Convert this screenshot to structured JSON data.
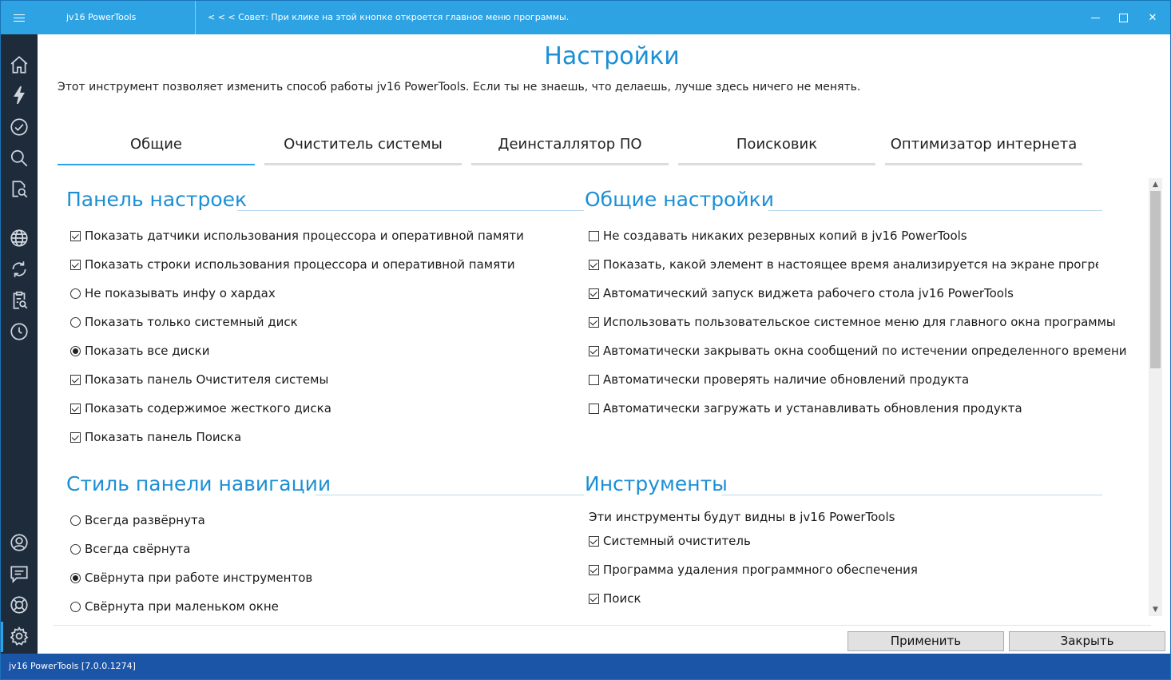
{
  "titlebar": {
    "app_name": "jv16 PowerTools",
    "tip": "< < < Совет: При клике на этой кнопке откроется главное меню программы."
  },
  "sidebar": {
    "top_icons": [
      "home-icon",
      "lightning-icon",
      "checkmark-circle-icon",
      "search-icon",
      "file-search-icon",
      "globe-icon",
      "refresh-icon",
      "clipboard-search-icon",
      "clock-icon"
    ],
    "bottom_icons": [
      "support-avatar-icon",
      "feedback-message-icon",
      "help-lifebuoy-icon",
      "settings-gear-icon"
    ],
    "active": "settings-gear-icon"
  },
  "page": {
    "title": "Настройки",
    "description": "Этот инструмент позволяет изменить способ работы jv16 PowerTools. Если ты не знаешь, что делаешь, лучше здесь ничего не менять."
  },
  "tabs": [
    {
      "label": "Общие",
      "active": true
    },
    {
      "label": "Очиститель системы",
      "active": false
    },
    {
      "label": "Деинсталлятор ПО",
      "active": false
    },
    {
      "label": "Поисковик",
      "active": false
    },
    {
      "label": "Оптимизатор интернета",
      "active": false
    }
  ],
  "settings_panel": {
    "title": "Панель настроек",
    "options": [
      {
        "type": "checkbox",
        "label": "Показать датчики использования процессора и оперативной памяти",
        "checked": true
      },
      {
        "type": "checkbox",
        "label": "Показать строки использования процессора и оперативной памяти",
        "checked": true
      },
      {
        "type": "radio",
        "label": "Не показывать инфу о хардах",
        "checked": false
      },
      {
        "type": "radio",
        "label": "Показать только системный диск",
        "checked": false
      },
      {
        "type": "radio",
        "label": "Показать все диски",
        "checked": true
      },
      {
        "type": "checkbox",
        "label": "Показать панель Очистителя системы",
        "checked": true
      },
      {
        "type": "checkbox",
        "label": "Показать содержимое жесткого диска",
        "checked": true
      },
      {
        "type": "checkbox",
        "label": "Показать панель Поиска",
        "checked": true
      }
    ]
  },
  "general_settings": {
    "title": "Общие настройки",
    "options": [
      {
        "type": "checkbox",
        "label": "Не создавать никаких резервных копий в jv16 PowerTools",
        "checked": false
      },
      {
        "type": "checkbox",
        "label": "Показать, какой элемент в настоящее время анализируется на экране прогресса скани",
        "checked": true
      },
      {
        "type": "checkbox",
        "label": "Автоматический запуск виджета рабочего стола jv16 PowerTools",
        "checked": true
      },
      {
        "type": "checkbox",
        "label": "Использовать пользовательское системное меню для главного окна программы",
        "checked": true
      },
      {
        "type": "checkbox",
        "label": "Автоматически закрывать окна сообщений по истечении определенного времени",
        "checked": true
      },
      {
        "type": "checkbox",
        "label": "Автоматически проверять наличие обновлений продукта",
        "checked": false
      },
      {
        "type": "checkbox",
        "label": "Автоматически загружать и устанавливать обновления продукта",
        "checked": false
      }
    ]
  },
  "nav_style": {
    "title": "Стиль панели навигации",
    "options": [
      {
        "type": "radio",
        "label": "Всегда развёрнута",
        "checked": false
      },
      {
        "type": "radio",
        "label": "Всегда свёрнута",
        "checked": false
      },
      {
        "type": "radio",
        "label": "Свёрнута при работе инструментов",
        "checked": true
      },
      {
        "type": "radio",
        "label": "Свёрнута при маленьком окне",
        "checked": false
      }
    ]
  },
  "tools": {
    "title": "Инструменты",
    "description": "Эти инструменты будут видны в jv16 PowerTools",
    "options": [
      {
        "type": "checkbox",
        "label": "Системный очиститель",
        "checked": true
      },
      {
        "type": "checkbox",
        "label": "Программа удаления программного обеспечения",
        "checked": true
      },
      {
        "type": "checkbox",
        "label": "Поиск",
        "checked": true
      }
    ]
  },
  "buttons": {
    "apply": "Применить",
    "close": "Закрыть"
  },
  "statusbar": {
    "text": "jv16 PowerTools [7.0.0.1274]"
  },
  "colors": {
    "titlebar": "#2ea3e3",
    "sidebar": "#1e2b3a",
    "accent": "#1b8fd6",
    "statusbar": "#1b55a8"
  }
}
